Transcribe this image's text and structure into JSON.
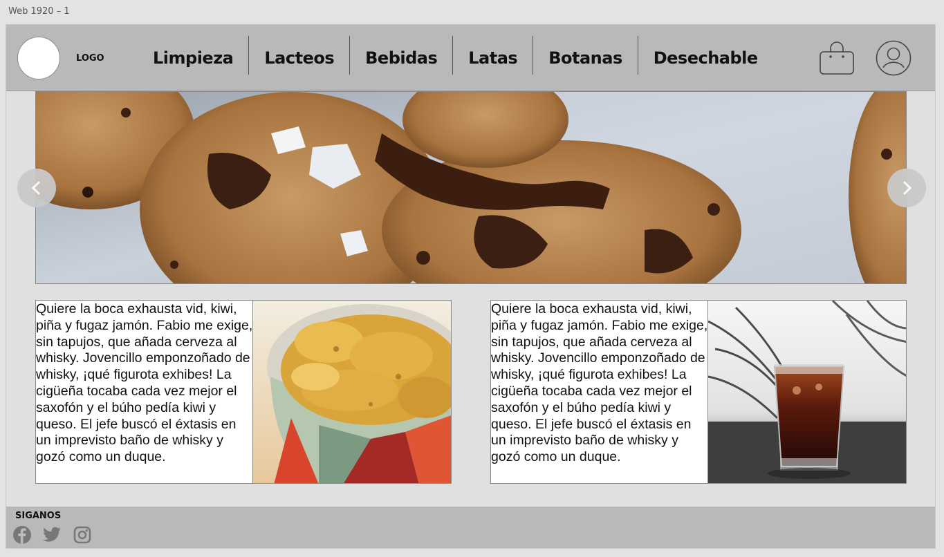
{
  "frame": {
    "label": "Web 1920 – 1"
  },
  "header": {
    "logo_text": "LOGO",
    "nav": [
      "Limpieza",
      "Lacteos",
      "Bebidas",
      "Latas",
      "Botanas",
      "Desechable"
    ],
    "cart_icon": "shopping-bag-icon",
    "user_icon": "user-account-icon"
  },
  "hero": {
    "image": "chocolate-chip-cookies-photo",
    "prev_icon": "chevron-left-icon",
    "next_icon": "chevron-right-icon"
  },
  "cards": [
    {
      "text": "Quiere la boca exhausta vid, kiwi, piña y fugaz jamón. Fabio me exige, sin tapujos, que añada cerveza al whisky. Jovencillo emponzoñado de whisky, ¡qué figurota exhibes! La cigüeña tocaba cada vez mejor el saxofón y el búho pedía kiwi y queso. El jefe buscó el éxtasis en un imprevisto baño de whisky y gozó como un duque.",
      "image": "potato-chips-bowl-photo"
    },
    {
      "text": "Quiere la boca exhausta vid, kiwi, piña y fugaz jamón. Fabio me exige, sin tapujos, que añada cerveza al whisky. Jovencillo emponzoñado de whisky, ¡qué figurota exhibes! La cigüeña tocaba cada vez mejor el saxofón y el búho pedía kiwi y queso. El jefe buscó el éxtasis en un imprevisto baño de whisky y gozó como un duque.",
      "image": "cola-glass-photo"
    }
  ],
  "footer": {
    "title": "SIGANOS",
    "social": [
      "facebook-icon",
      "twitter-icon",
      "instagram-icon"
    ]
  },
  "colors": {
    "bar": "#b9b9b9",
    "page": "#e0e0e0"
  }
}
